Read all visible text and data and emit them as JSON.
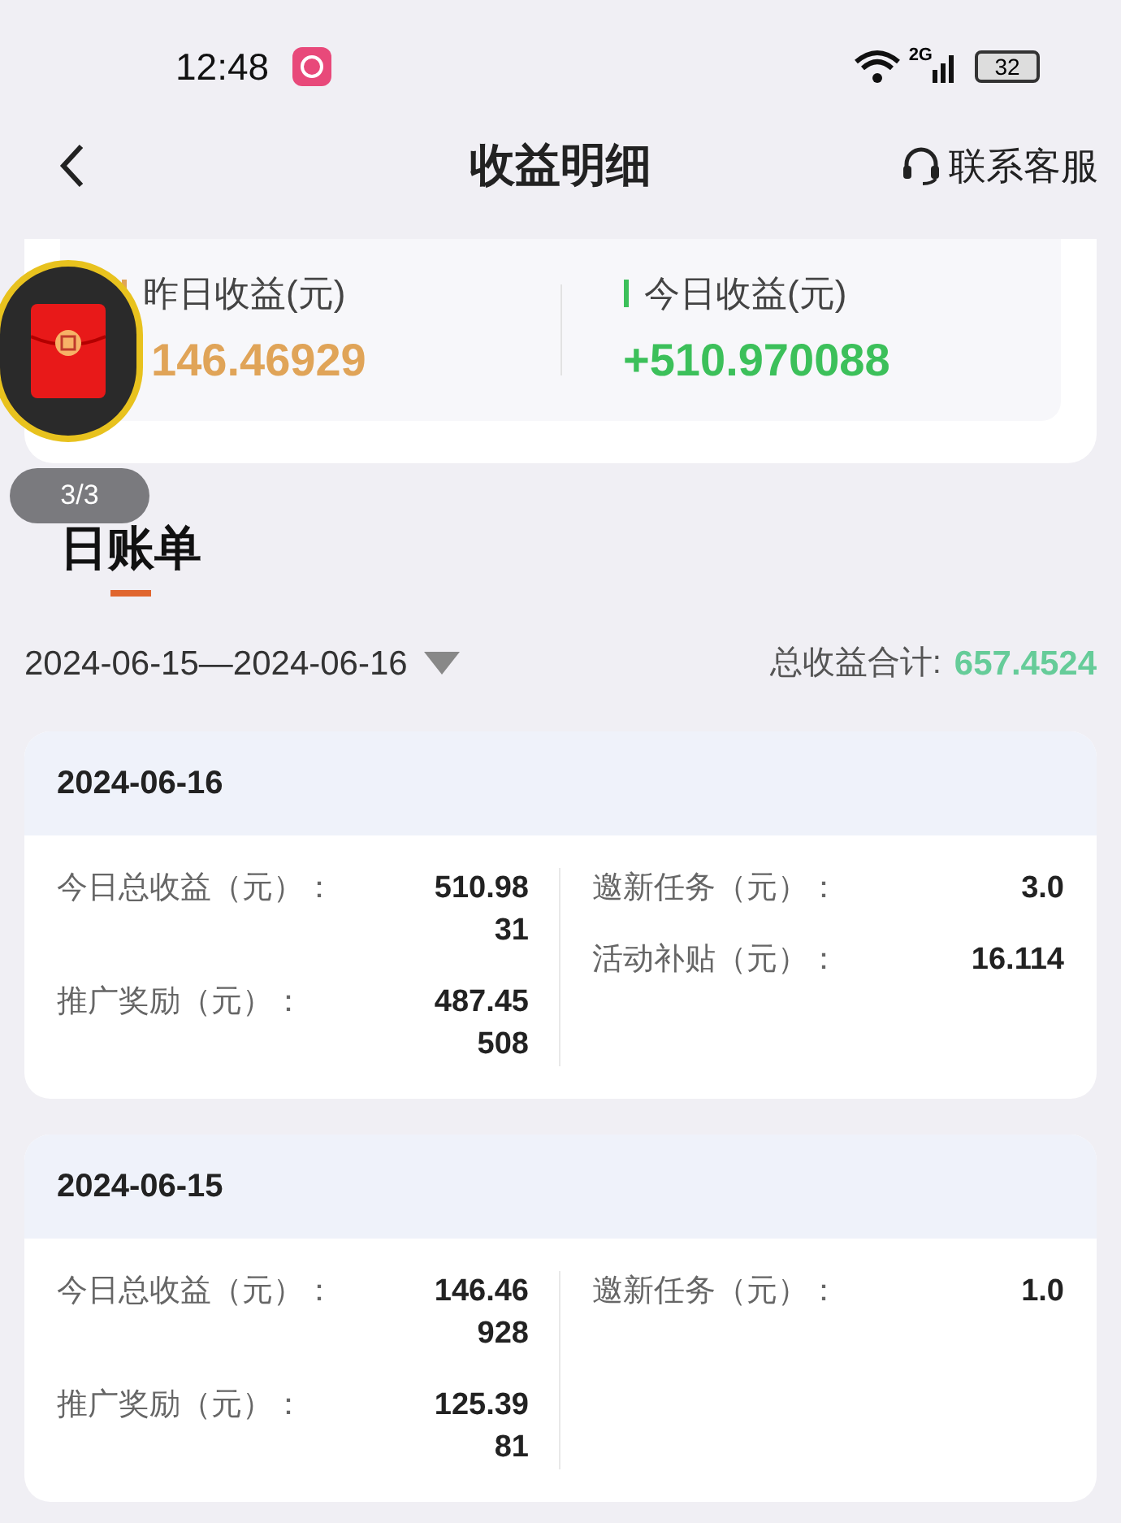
{
  "status_bar": {
    "time": "12:48",
    "network": "2G",
    "battery": "32"
  },
  "header": {
    "title": "收益明细",
    "service_link": "联系客服"
  },
  "summary": [
    {
      "label": "昨日收益(元)",
      "value": "146.46929",
      "color": "#e0a458"
    },
    {
      "label": "今日收益(元)",
      "value": "+510.970088",
      "color": "#3cc05a"
    }
  ],
  "float_badge": {
    "counter": "3/3"
  },
  "section": {
    "title": "日账单"
  },
  "filter": {
    "date_range": "2024-06-15—2024-06-16",
    "total_label": "总收益合计:",
    "total_value": "657.4524"
  },
  "days": [
    {
      "date": "2024-06-16",
      "left": [
        {
          "label": "今日总收益（元）：",
          "value": "510.9831"
        },
        {
          "label": "推广奖励（元）：",
          "value": "487.45508"
        }
      ],
      "right": [
        {
          "label": "邀新任务（元）：",
          "value": "3.0"
        },
        {
          "label": "活动补贴（元）：",
          "value": "16.114"
        }
      ]
    },
    {
      "date": "2024-06-15",
      "left": [
        {
          "label": "今日总收益（元）：",
          "value": "146.46928"
        },
        {
          "label": "推广奖励（元）：",
          "value": "125.3981"
        }
      ],
      "right": [
        {
          "label": "邀新任务（元）：",
          "value": "1.0"
        }
      ]
    }
  ]
}
